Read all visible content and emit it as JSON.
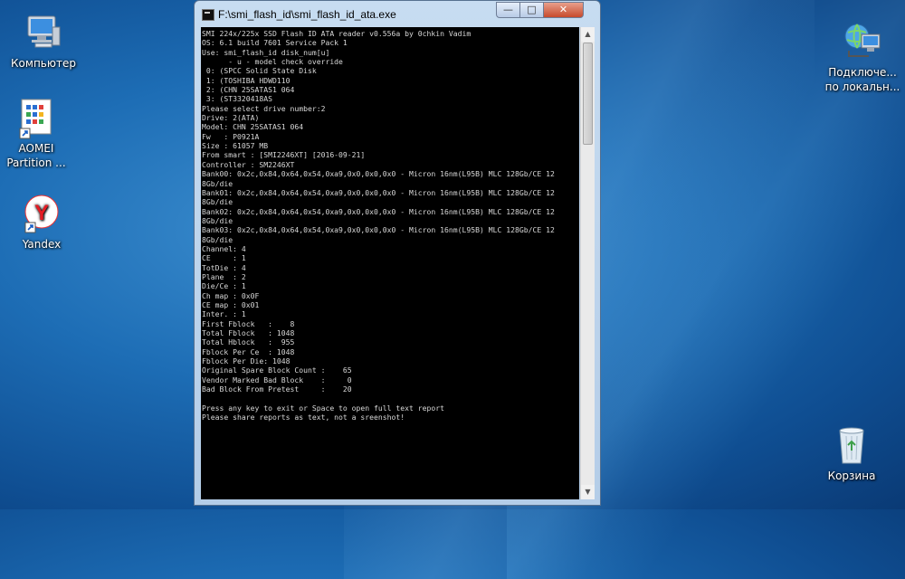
{
  "desktop": {
    "icons": [
      {
        "label": "Компьютер"
      },
      {
        "label": "AOMEI Partition ..."
      },
      {
        "label": "Yandex"
      },
      {
        "label": "Подключе... по локальн..."
      },
      {
        "label": "Корзина"
      }
    ]
  },
  "window": {
    "title": "F:\\smi_flash_id\\smi_flash_id_ata.exe",
    "controls": {
      "minimize": "—",
      "maximize": "□",
      "close": "✕"
    }
  },
  "console": {
    "lines": [
      "SMI 224x/225x SSD Flash ID ATA reader v0.556a by 0chkin Vadim",
      "OS: 6.1 build 7601 Service Pack 1",
      "Use: smi_flash_id disk_num[u]",
      "      - u - model check override",
      " 0: (SPCC Solid State Disk",
      " 1: (TOSHIBA HDWD110",
      " 2: (CHN 25SATAS1 064",
      " 3: (ST3320418AS",
      "Please select drive number:2",
      "Drive: 2(ATA)",
      "Model: CHN 25SATAS1 064",
      "Fw   : P0921A",
      "Size : 61057 MB",
      "From smart : [SMI2246XT] [2016-09-21]",
      "Controller : SM2246XT",
      "Bank00: 0x2c,0x84,0x64,0x54,0xa9,0x0,0x0,0x0 - Micron 16nm(L95B) MLC 128Gb/CE 12",
      "8Gb/die",
      "Bank01: 0x2c,0x84,0x64,0x54,0xa9,0x0,0x0,0x0 - Micron 16nm(L95B) MLC 128Gb/CE 12",
      "8Gb/die",
      "Bank02: 0x2c,0x84,0x64,0x54,0xa9,0x0,0x0,0x0 - Micron 16nm(L95B) MLC 128Gb/CE 12",
      "8Gb/die",
      "Bank03: 0x2c,0x84,0x64,0x54,0xa9,0x0,0x0,0x0 - Micron 16nm(L95B) MLC 128Gb/CE 12",
      "8Gb/die",
      "Channel: 4",
      "CE     : 1",
      "TotDie : 4",
      "Plane  : 2",
      "Die/Ce : 1",
      "Ch map : 0x0F",
      "CE map : 0x01",
      "Inter. : 1",
      "First Fblock   :    8",
      "Total Fblock   : 1048",
      "Total Hblock   :  955",
      "Fblock Per Ce  : 1048",
      "Fblock Per Die: 1048",
      "Original Spare Block Count :    65",
      "Vendor Marked Bad Block    :     0",
      "Bad Block From Pretest     :    20",
      "",
      "Press any key to exit or Space to open full text report",
      "Please share reports as text, not a sreenshot!"
    ]
  },
  "colors": {
    "console_bg": "#000000",
    "console_text": "#d8d8d8",
    "desktop_bg": "#1d6db5",
    "close_button": "#c74a2c"
  },
  "scrollbar": {
    "up_arrow": "▲",
    "down_arrow": "▼"
  }
}
